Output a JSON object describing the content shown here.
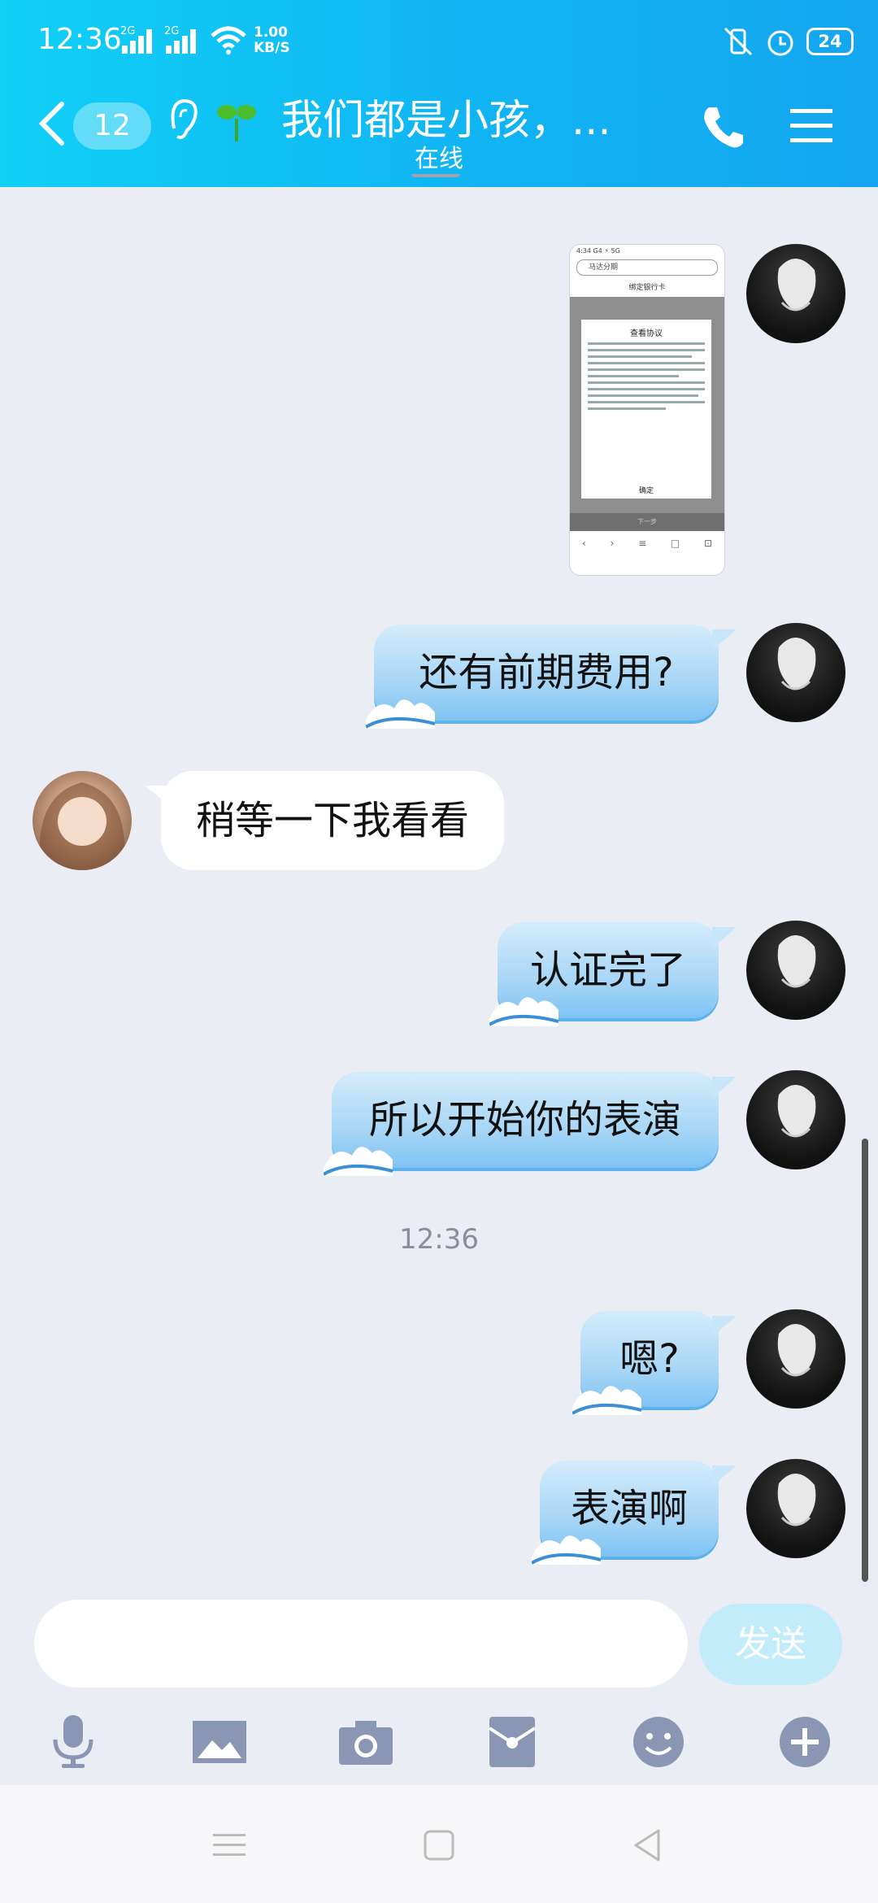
{
  "status_bar": {
    "time": "12:36",
    "signal1_label": "2G",
    "signal2_label": "2G",
    "net_speed_value": "1.00",
    "net_speed_unit": "KB/S",
    "battery": "24"
  },
  "header": {
    "unread_count": "12",
    "title": "我们都是小孩，...",
    "subtitle": "在线"
  },
  "thumbnail": {
    "status": "4:34 G4 ⚡ 5G",
    "search": "马达分期",
    "page_title": "绑定银行卡",
    "dialog_title": "查看协议",
    "ok": "确定",
    "next": "下一步"
  },
  "messages": [
    {
      "side": "out",
      "text": "还有前期费用?"
    },
    {
      "side": "in",
      "text": "稍等一下我看看"
    },
    {
      "side": "out",
      "text": "认证完了"
    },
    {
      "side": "out",
      "text": "所以开始你的表演"
    },
    {
      "side": "out",
      "text": "嗯?"
    },
    {
      "side": "out",
      "text": "表演啊"
    }
  ],
  "time_separator": "12:36",
  "composer": {
    "placeholder": "",
    "send_label": "发送"
  },
  "toolbar_icons": [
    "microphone-icon",
    "image-icon",
    "camera-icon",
    "red-packet-icon",
    "emoji-icon",
    "plus-icon"
  ],
  "colors": {
    "header_start": "#10d0f6",
    "header_end": "#14a6ef",
    "chat_background": "#ebedf5",
    "bubble_out": "#a8d6f6",
    "send_button": "#c3ecfb",
    "toolbar_icon": "#8a96b3"
  }
}
